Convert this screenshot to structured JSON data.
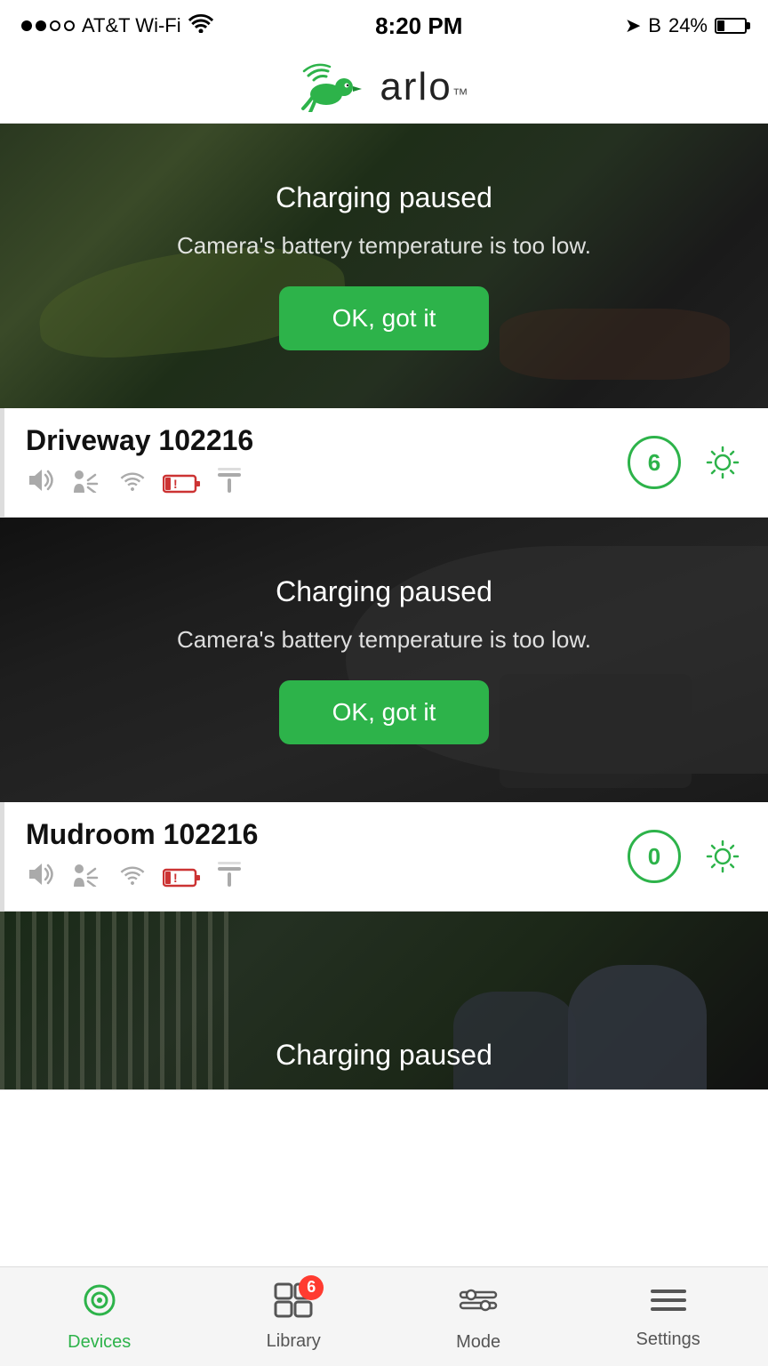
{
  "statusBar": {
    "carrier": "AT&T Wi-Fi",
    "time": "8:20 PM",
    "battery_pct": "24%"
  },
  "header": {
    "logo_text": "arlo",
    "logo_tm": "™"
  },
  "cameras": [
    {
      "name": "Driveway 102216",
      "clip_count": "6",
      "charging_title": "Charging paused",
      "charging_subtitle": "Camera's battery temperature is too low.",
      "ok_button": "OK, got it"
    },
    {
      "name": "Mudroom 102216",
      "clip_count": "0",
      "charging_title": "Charging paused",
      "charging_subtitle": "Camera's battery temperature is too low.",
      "ok_button": "OK, got it"
    }
  ],
  "lastFeed": {
    "charging_title": "Charging paused"
  },
  "bottomNav": {
    "devices_label": "Devices",
    "library_label": "Library",
    "mode_label": "Mode",
    "settings_label": "Settings",
    "library_badge": "6"
  }
}
